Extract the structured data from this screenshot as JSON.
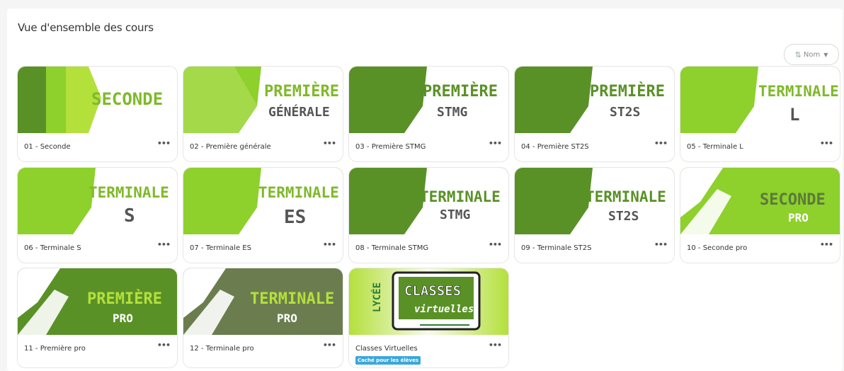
{
  "page": {
    "title": "Vue d'ensemble des cours"
  },
  "sort": {
    "label": "Nom",
    "icon": "sort-icon"
  },
  "colors": {
    "lime": "#8ed02c",
    "green": "#5a9127",
    "olive": "#6b7d4e",
    "lightgreen": "#b4e03c",
    "badge": "#3aa7dc"
  },
  "courses": [
    {
      "title": "01 - Seconde",
      "line1": "SECONDE",
      "line2": ""
    },
    {
      "title": "02 - Première générale",
      "line1": "PREMIÈRE",
      "line2": "GÉNÉRALE"
    },
    {
      "title": "03 - Première STMG",
      "line1": "PREMIÈRE",
      "line2": "STMG"
    },
    {
      "title": "04 - Première ST2S",
      "line1": "PREMIÈRE",
      "line2": "ST2S"
    },
    {
      "title": "05 - Terminale L",
      "line1": "TERMINALE",
      "line2": "L"
    },
    {
      "title": "06 - Terminale S",
      "line1": "TERMINALE",
      "line2": "S"
    },
    {
      "title": "07 - Terminale ES",
      "line1": "TERMINALE",
      "line2": "ES"
    },
    {
      "title": "08 - Terminale STMG",
      "line1": "TERMINALE",
      "line2": "STMG"
    },
    {
      "title": "09 - Terminale ST2S",
      "line1": "TERMINALE",
      "line2": "ST2S"
    },
    {
      "title": "10 - Seconde pro",
      "line1": "SECONDE",
      "line2": "PRO"
    },
    {
      "title": "11 - Première pro",
      "line1": "PREMIÈRE",
      "line2": "PRO"
    },
    {
      "title": "12 - Terminale pro",
      "line1": "TERMINALE",
      "line2": "PRO"
    },
    {
      "title": "Classes Virtuelles",
      "badge": "Caché pour les élèves",
      "side": "LYCÉE",
      "line1": "CLASSES",
      "line2": "virtuelles"
    }
  ],
  "menu_label": "•••"
}
